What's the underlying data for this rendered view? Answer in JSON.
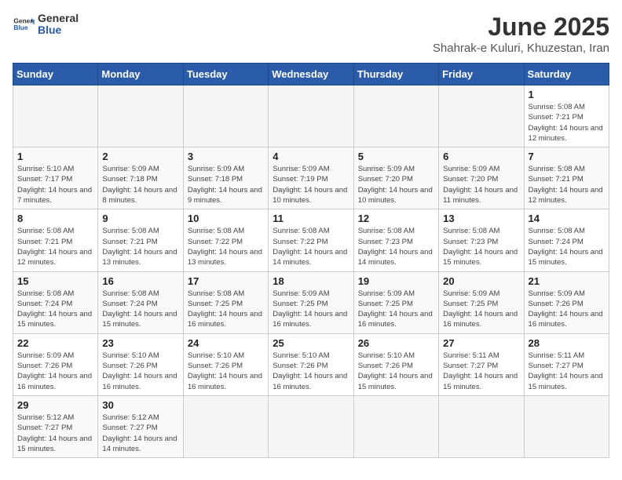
{
  "header": {
    "logo_general": "General",
    "logo_blue": "Blue",
    "title": "June 2025",
    "subtitle": "Shahrak-e Kuluri, Khuzestan, Iran"
  },
  "calendar": {
    "days_of_week": [
      "Sunday",
      "Monday",
      "Tuesday",
      "Wednesday",
      "Thursday",
      "Friday",
      "Saturday"
    ],
    "weeks": [
      [
        null,
        null,
        null,
        null,
        null,
        null,
        {
          "day": 1,
          "sunrise": "5:08 AM",
          "sunset": "7:21 PM",
          "daylight": "14 hours and 12 minutes."
        }
      ],
      [
        {
          "day": 1,
          "sunrise": "5:10 AM",
          "sunset": "7:17 PM",
          "daylight": "14 hours and 7 minutes."
        },
        {
          "day": 2,
          "sunrise": "5:09 AM",
          "sunset": "7:18 PM",
          "daylight": "14 hours and 8 minutes."
        },
        {
          "day": 3,
          "sunrise": "5:09 AM",
          "sunset": "7:18 PM",
          "daylight": "14 hours and 9 minutes."
        },
        {
          "day": 4,
          "sunrise": "5:09 AM",
          "sunset": "7:19 PM",
          "daylight": "14 hours and 10 minutes."
        },
        {
          "day": 5,
          "sunrise": "5:09 AM",
          "sunset": "7:20 PM",
          "daylight": "14 hours and 10 minutes."
        },
        {
          "day": 6,
          "sunrise": "5:09 AM",
          "sunset": "7:20 PM",
          "daylight": "14 hours and 11 minutes."
        },
        {
          "day": 7,
          "sunrise": "5:08 AM",
          "sunset": "7:21 PM",
          "daylight": "14 hours and 12 minutes."
        }
      ],
      [
        {
          "day": 8,
          "sunrise": "5:08 AM",
          "sunset": "7:21 PM",
          "daylight": "14 hours and 12 minutes."
        },
        {
          "day": 9,
          "sunrise": "5:08 AM",
          "sunset": "7:21 PM",
          "daylight": "14 hours and 13 minutes."
        },
        {
          "day": 10,
          "sunrise": "5:08 AM",
          "sunset": "7:22 PM",
          "daylight": "14 hours and 13 minutes."
        },
        {
          "day": 11,
          "sunrise": "5:08 AM",
          "sunset": "7:22 PM",
          "daylight": "14 hours and 14 minutes."
        },
        {
          "day": 12,
          "sunrise": "5:08 AM",
          "sunset": "7:23 PM",
          "daylight": "14 hours and 14 minutes."
        },
        {
          "day": 13,
          "sunrise": "5:08 AM",
          "sunset": "7:23 PM",
          "daylight": "14 hours and 15 minutes."
        },
        {
          "day": 14,
          "sunrise": "5:08 AM",
          "sunset": "7:24 PM",
          "daylight": "14 hours and 15 minutes."
        }
      ],
      [
        {
          "day": 15,
          "sunrise": "5:08 AM",
          "sunset": "7:24 PM",
          "daylight": "14 hours and 15 minutes."
        },
        {
          "day": 16,
          "sunrise": "5:08 AM",
          "sunset": "7:24 PM",
          "daylight": "14 hours and 15 minutes."
        },
        {
          "day": 17,
          "sunrise": "5:08 AM",
          "sunset": "7:25 PM",
          "daylight": "14 hours and 16 minutes."
        },
        {
          "day": 18,
          "sunrise": "5:09 AM",
          "sunset": "7:25 PM",
          "daylight": "14 hours and 16 minutes."
        },
        {
          "day": 19,
          "sunrise": "5:09 AM",
          "sunset": "7:25 PM",
          "daylight": "14 hours and 16 minutes."
        },
        {
          "day": 20,
          "sunrise": "5:09 AM",
          "sunset": "7:25 PM",
          "daylight": "14 hours and 16 minutes."
        },
        {
          "day": 21,
          "sunrise": "5:09 AM",
          "sunset": "7:26 PM",
          "daylight": "14 hours and 16 minutes."
        }
      ],
      [
        {
          "day": 22,
          "sunrise": "5:09 AM",
          "sunset": "7:26 PM",
          "daylight": "14 hours and 16 minutes."
        },
        {
          "day": 23,
          "sunrise": "5:10 AM",
          "sunset": "7:26 PM",
          "daylight": "14 hours and 16 minutes."
        },
        {
          "day": 24,
          "sunrise": "5:10 AM",
          "sunset": "7:26 PM",
          "daylight": "14 hours and 16 minutes."
        },
        {
          "day": 25,
          "sunrise": "5:10 AM",
          "sunset": "7:26 PM",
          "daylight": "14 hours and 16 minutes."
        },
        {
          "day": 26,
          "sunrise": "5:10 AM",
          "sunset": "7:26 PM",
          "daylight": "14 hours and 15 minutes."
        },
        {
          "day": 27,
          "sunrise": "5:11 AM",
          "sunset": "7:27 PM",
          "daylight": "14 hours and 15 minutes."
        },
        {
          "day": 28,
          "sunrise": "5:11 AM",
          "sunset": "7:27 PM",
          "daylight": "14 hours and 15 minutes."
        }
      ],
      [
        {
          "day": 29,
          "sunrise": "5:12 AM",
          "sunset": "7:27 PM",
          "daylight": "14 hours and 15 minutes."
        },
        {
          "day": 30,
          "sunrise": "5:12 AM",
          "sunset": "7:27 PM",
          "daylight": "14 hours and 14 minutes."
        },
        null,
        null,
        null,
        null,
        null
      ]
    ]
  }
}
